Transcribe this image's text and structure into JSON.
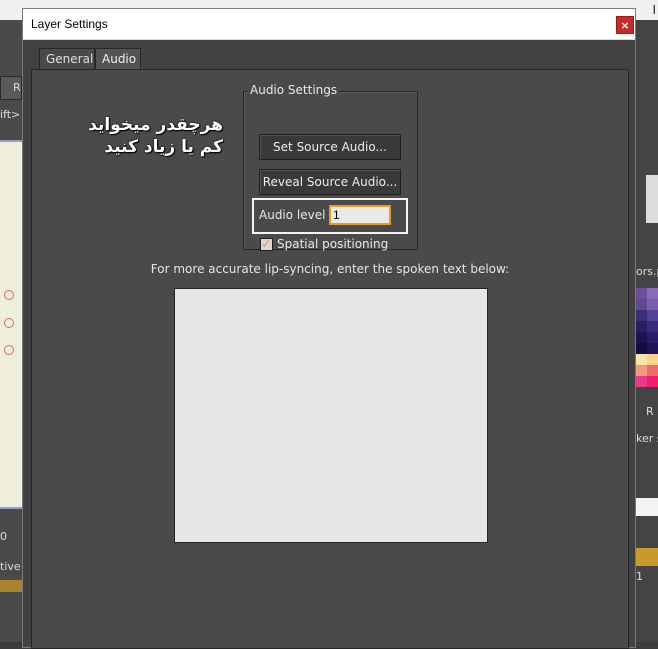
{
  "dialog": {
    "title": "Layer Settings",
    "close_glyph": "×",
    "tabs": [
      {
        "label": "General",
        "active": false
      },
      {
        "label": "Audio",
        "active": true
      }
    ]
  },
  "audio_settings": {
    "group_title": "Audio Settings",
    "set_source_label": "Set Source Audio...",
    "reveal_source_label": "Reveal Source Audio...",
    "audio_level_label": "Audio level",
    "audio_level_value": "1",
    "spatial_positioning_label": "Spatial positioning",
    "spatial_positioning_checked": true,
    "check_glyph": "✓"
  },
  "lip_sync": {
    "hint": "For more accurate lip-syncing, enter the spoken text below:",
    "text": ""
  },
  "overlay_annotation": {
    "line1": "هرچقدر میخواید",
    "line2": "کم یا زیاد کنید"
  },
  "background": {
    "left_button_text": "Re",
    "left_text_1": "ift>",
    "left_text_2": "0",
    "left_text_3": "tive",
    "right_text_1": "ors.p",
    "right_text_2": "R",
    "right_text_3": "ker s",
    "right_text_4": "1",
    "top_right_glyph": "I"
  },
  "colors": {
    "accent_orange": "#e79a1e",
    "close_red": "#c42b2b",
    "dialog_bg": "#4a4a4a"
  }
}
